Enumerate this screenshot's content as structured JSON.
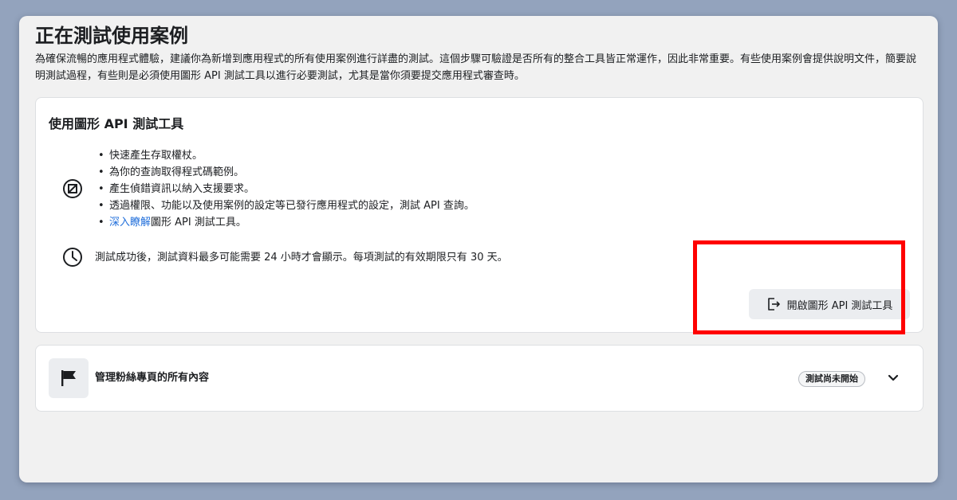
{
  "page": {
    "title": "正在測試使用案例",
    "description": "為確保流暢的應用程式體驗，建議你為新增到應用程式的所有使用案例進行詳盡的測試。這個步驟可驗證是否所有的整合工具皆正常運作，因此非常重要。有些使用案例會提供說明文件，簡要說明測試過程，有些則是必須使用圖形 API 測試工具以進行必要測試，尤其是當你須要提交應用程式審查時。"
  },
  "graph_api_card": {
    "title": "使用圖形 API 測試工具",
    "bullets": [
      "快速產生存取權杖。",
      "為你的查詢取得程式碼範例。",
      "產生偵錯資訊以納入支援要求。",
      "透過權限、功能以及使用案例的設定等已發行應用程式的設定，測試 API 查詢。"
    ],
    "learn_more_link": "深入瞭解",
    "learn_more_suffix": "圖形 API 測試工具。",
    "note": "測試成功後，測試資料最多可能需要 24 小時才會顯示。每項測試的有效期限只有 30 天。",
    "open_button_label": "開啟圖形 API 測試工具"
  },
  "usecase_card": {
    "title": "管理粉絲專頁的所有內容",
    "status": "測試尚未開始"
  },
  "icons": {
    "tool": "graph-api-tool-icon",
    "clock": "clock-icon",
    "open": "open-external-icon",
    "flag": "flag-icon",
    "chevron": "chevron-down-icon"
  },
  "colors": {
    "link": "#216fdb",
    "highlight": "#ff0000",
    "window_bg": "#f1f1f1",
    "backdrop": "#93a3bd"
  }
}
